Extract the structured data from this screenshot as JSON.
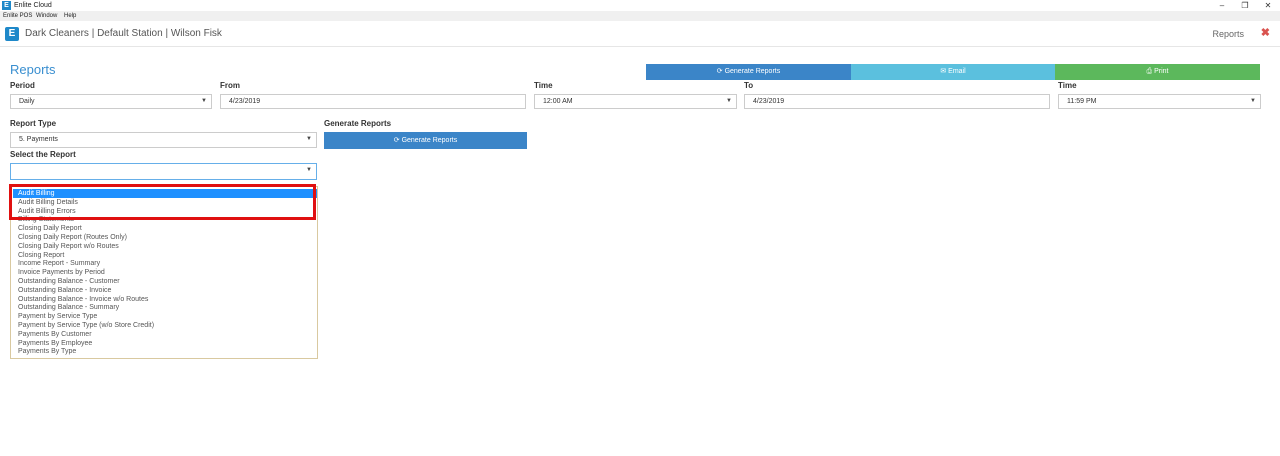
{
  "window": {
    "title": "Enlite Cloud",
    "app_icon_letter": "E",
    "controls": [
      "–",
      "❐",
      "✕"
    ]
  },
  "menu": {
    "items": [
      "Enlite POS",
      "Window",
      "Help"
    ]
  },
  "header": {
    "logo_letter": "E",
    "title": "Dark Cleaners | Default Station | Wilson Fisk",
    "right_label": "Reports",
    "close_glyph": "✖"
  },
  "page": {
    "title": "Reports"
  },
  "actions": {
    "generate": "Generate Reports",
    "email": "Email",
    "print": "Print"
  },
  "form": {
    "period_label": "Period",
    "period_value": "Daily",
    "from_label": "From",
    "from_value": "4/23/2019",
    "time_label": "Time",
    "time_from_value": "12:00 AM",
    "to_label": "To",
    "to_value": "4/23/2019",
    "time2_label": "Time",
    "time_to_value": "11:59 PM",
    "report_type_label": "Report Type",
    "report_type_value": "5. Payments",
    "generate_label": "Generate Reports",
    "generate_button": "Generate Reports",
    "select_report_label": "Select the Report",
    "select_report_value": ""
  },
  "report_options": [
    "Audit Billing",
    "Audit Billing Details",
    "Audit Billing Errors",
    "Billing Statements",
    "Closing Daily Report",
    "Closing Daily Report (Routes Only)",
    "Closing Daily Report w/o Routes",
    "Closing Report",
    "Income Report - Summary",
    "Invoice Payments by Period",
    "Outstanding Balance - Customer",
    "Outstanding Balance - Invoice",
    "Outstanding Balance - Invoice w/o Routes",
    "Outstanding Balance - Summary",
    "Payment by Service Type",
    "Payment by Service Type (w/o Store Credit)",
    "Payments By Customer",
    "Payments By Employee",
    "Payments By Type"
  ],
  "selected_option_index": 0,
  "colors": {
    "accent": "#3a8fd0",
    "generate": "#3b85c8",
    "email": "#5bc0de",
    "print": "#5cb85c",
    "highlight": "#e01010",
    "selected_option": "#1e90ff"
  }
}
